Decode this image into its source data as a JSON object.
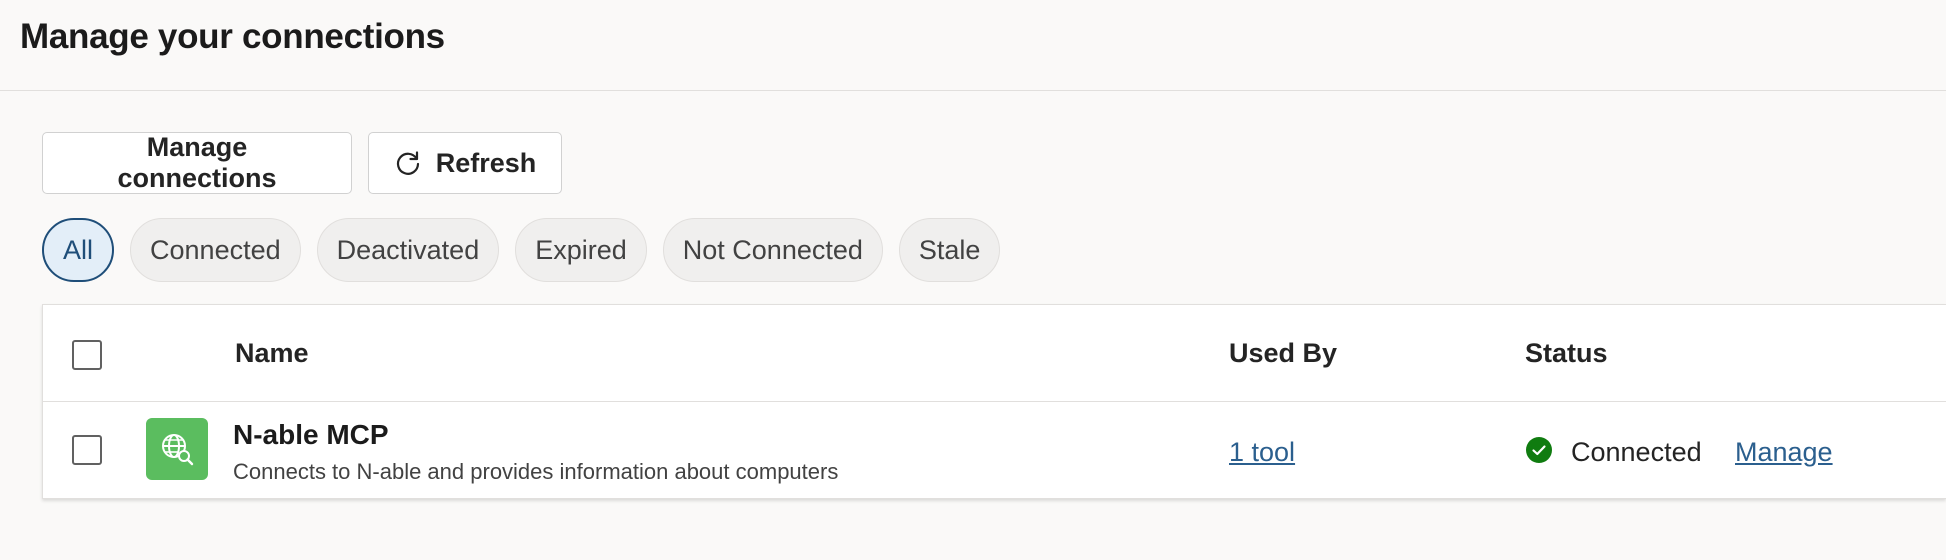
{
  "header": {
    "title": "Manage your connections"
  },
  "toolbar": {
    "manage_label": "Manage connections",
    "refresh_label": "Refresh",
    "refresh_icon": "refresh-icon"
  },
  "filters": {
    "active": "All",
    "items": [
      "All",
      "Connected",
      "Deactivated",
      "Expired",
      "Not Connected",
      "Stale"
    ]
  },
  "table": {
    "columns": {
      "name": "Name",
      "used_by": "Used By",
      "status": "Status"
    },
    "rows": [
      {
        "icon": "globe-search-icon",
        "name": "N-able MCP",
        "description": "Connects to N-able and provides information about computers",
        "used_by": "1 tool",
        "status": "Connected",
        "status_icon": "check-circle-icon",
        "action": "Manage",
        "selected": false
      }
    ]
  },
  "colors": {
    "background": "#faf9f8",
    "accent": "#1f4e79",
    "link": "#2b5f8e",
    "app_icon_bg": "#5bbd5f",
    "status_connected": "#107c10"
  }
}
